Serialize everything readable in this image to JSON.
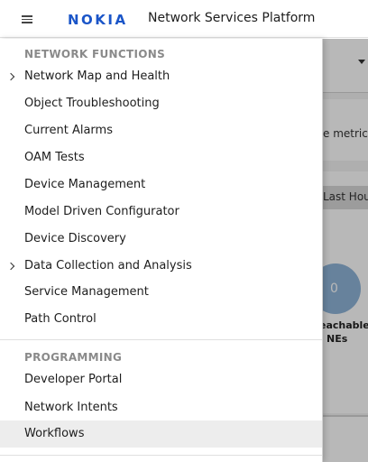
{
  "header": {
    "brand": "NOKIA",
    "title": "Network Services Platform"
  },
  "background": {
    "metrics_text": "e metrics",
    "time_range": "Last Hou",
    "gauge_value": "0",
    "unreachable_line1": "eachable",
    "unreachable_line2": "NEs"
  },
  "drawer": {
    "network_functions": {
      "header": "NETWORK FUNCTIONS",
      "items": [
        {
          "label": "Network Map and Health",
          "expandable": true
        },
        {
          "label": "Object Troubleshooting",
          "expandable": false
        },
        {
          "label": "Current Alarms",
          "expandable": false
        },
        {
          "label": "OAM Tests",
          "expandable": false
        },
        {
          "label": "Device Management",
          "expandable": false
        },
        {
          "label": "Model Driven Configurator",
          "expandable": false
        },
        {
          "label": "Device Discovery",
          "expandable": false
        },
        {
          "label": "Data Collection and Analysis",
          "expandable": true
        },
        {
          "label": "Service Management",
          "expandable": false
        },
        {
          "label": "Path Control",
          "expandable": false
        }
      ]
    },
    "programming": {
      "header": "PROGRAMMING",
      "items": [
        {
          "label": "Developer Portal",
          "active": false
        },
        {
          "label": "Network Intents",
          "active": false
        },
        {
          "label": "Workflows",
          "active": true
        }
      ]
    }
  },
  "colors": {
    "brand": "#1a55c8",
    "section_header": "#8a8a8a",
    "active_item_bg": "#ededed"
  }
}
